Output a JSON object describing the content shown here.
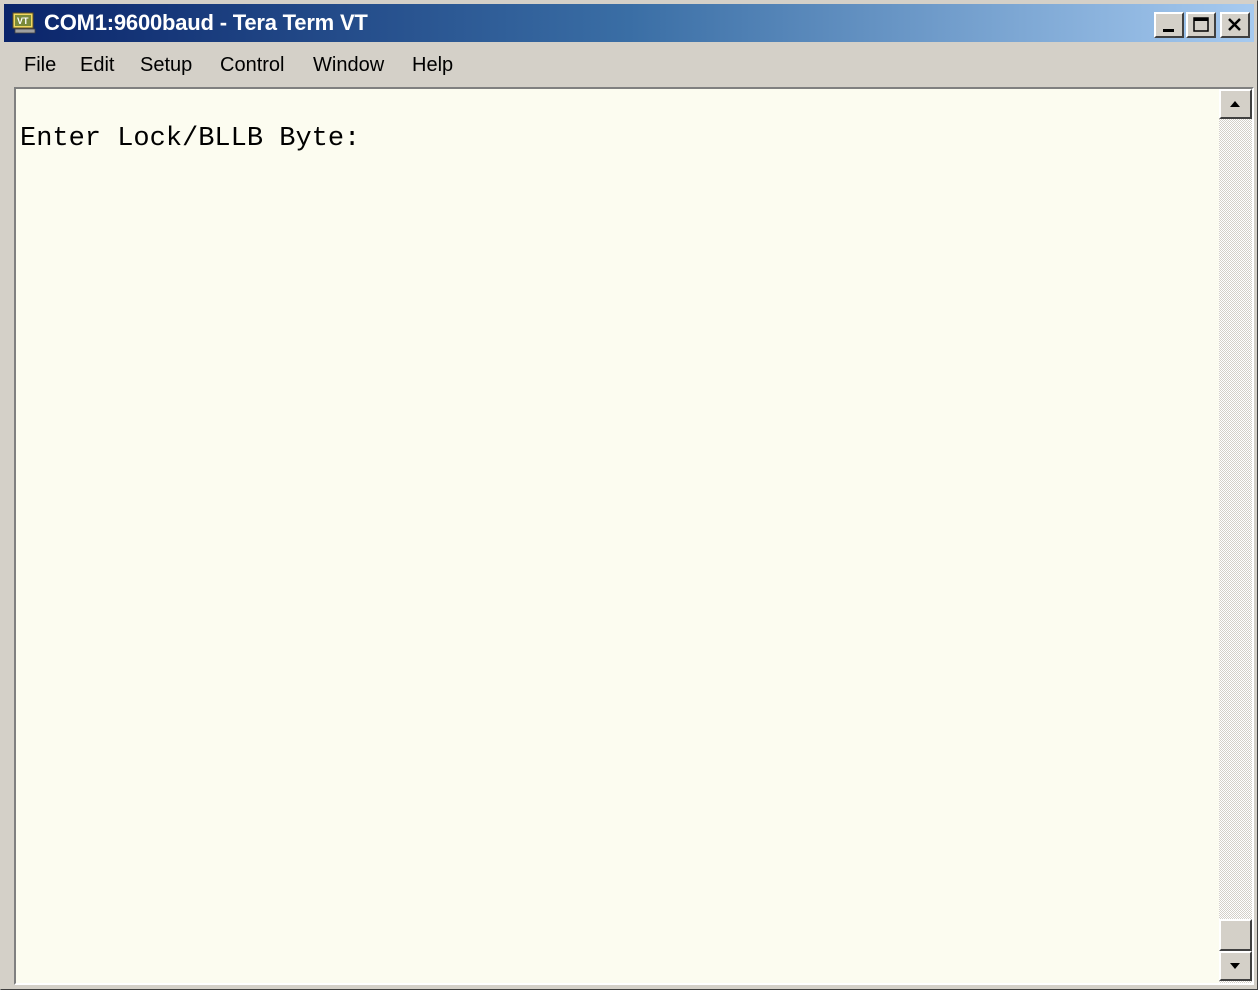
{
  "window": {
    "title": "COM1:9600baud - Tera Term VT",
    "icon": "teraterm-vt-icon"
  },
  "caption_buttons": [
    "minimize-icon",
    "maximize-icon",
    "close-icon"
  ],
  "menu": {
    "file": "File",
    "edit": "Edit",
    "setup": "Setup",
    "control": "Control",
    "window": "Window",
    "help": "Help"
  },
  "terminal": {
    "lines": [
      "Enter Lock/BLLB Byte:"
    ],
    "background": "#fcfcf0",
    "foreground": "#000000"
  },
  "scrollbar": {
    "up_icon": "arrow-up-icon",
    "down_icon": "arrow-down-icon"
  }
}
